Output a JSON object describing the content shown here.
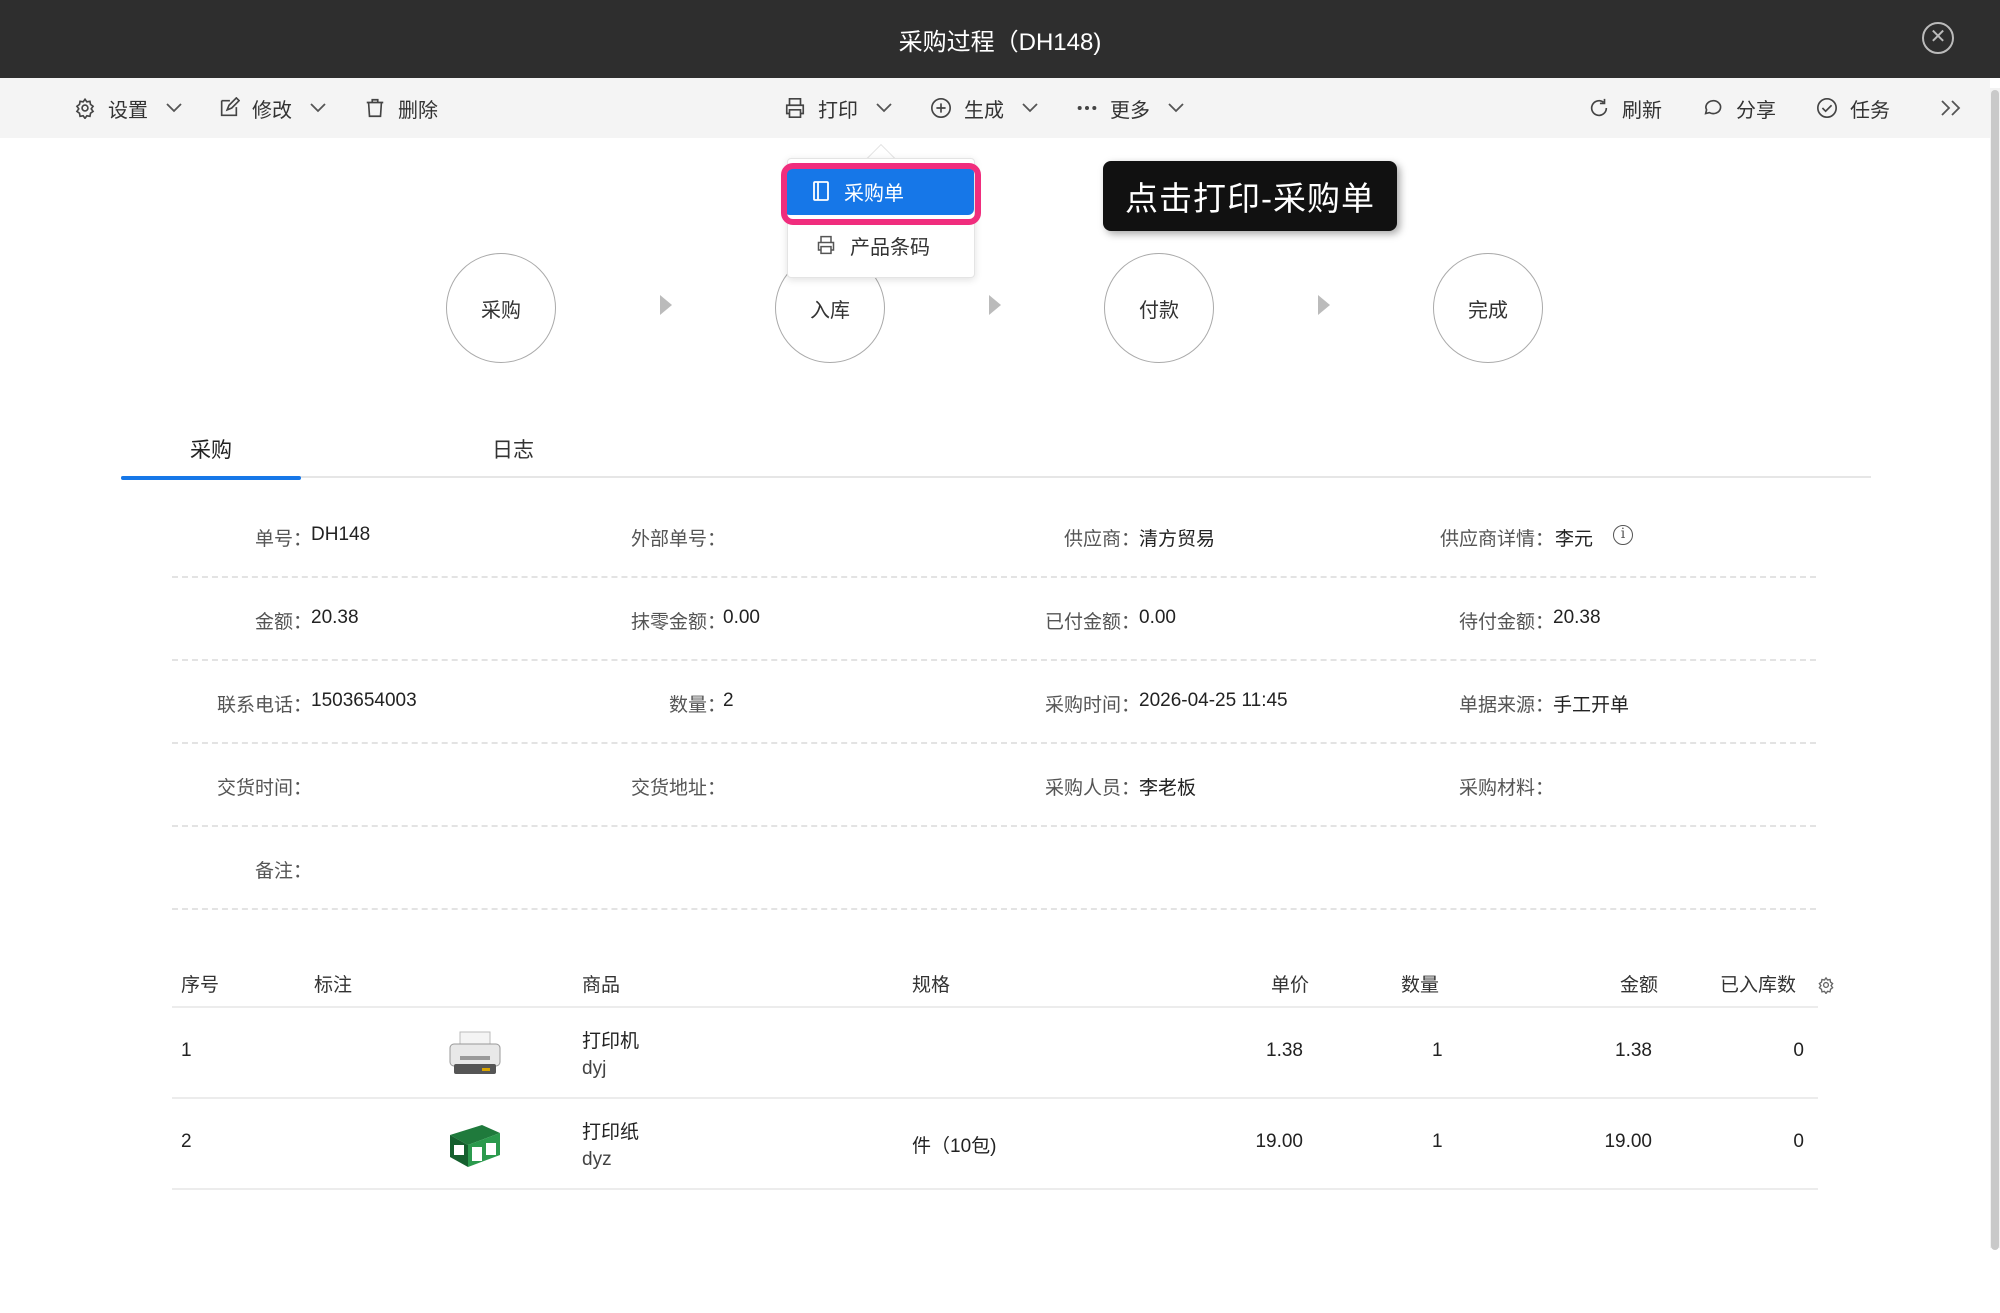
{
  "window": {
    "title": "采购过程（DH148)",
    "close_icon": "close-icon"
  },
  "toolbar": {
    "settings": "设置",
    "edit": "修改",
    "delete": "删除",
    "print": "打印",
    "generate": "生成",
    "more": "更多",
    "refresh": "刷新",
    "share": "分享",
    "task": "任务"
  },
  "print_menu": {
    "items": [
      "采购单",
      "产品条码"
    ],
    "selected": "采购单"
  },
  "callout": "点击打印-采购单",
  "steps": [
    "采购",
    "入库",
    "付款",
    "完成"
  ],
  "tabs": [
    "采购",
    "日志"
  ],
  "fields": {
    "order_no": {
      "label": "单号：",
      "value": "DH148"
    },
    "external_no": {
      "label": "外部单号：",
      "value": ""
    },
    "supplier": {
      "label": "供应商：",
      "value": "清方贸易"
    },
    "supplier_detail": {
      "label": "供应商详情：",
      "value": "李元"
    },
    "amount": {
      "label": "金额：",
      "value": "20.38"
    },
    "rounding": {
      "label": "抹零金额：",
      "value": "0.00"
    },
    "paid": {
      "label": "已付金额：",
      "value": "0.00"
    },
    "due": {
      "label": "待付金额：",
      "value": "20.38"
    },
    "phone": {
      "label": "联系电话：",
      "value": "1503654003"
    },
    "quantity": {
      "label": "数量：",
      "value": "2"
    },
    "purchase_time": {
      "label": "采购时间：",
      "value": "2026-04-25 11:45"
    },
    "source": {
      "label": "单据来源：",
      "value": "手工开单"
    },
    "delivery_time": {
      "label": "交货时间：",
      "value": ""
    },
    "delivery_addr": {
      "label": "交货地址：",
      "value": ""
    },
    "purchaser": {
      "label": "采购人员：",
      "value": "李老板"
    },
    "material": {
      "label": "采购材料：",
      "value": ""
    },
    "remark": {
      "label": "备注：",
      "value": ""
    }
  },
  "table": {
    "headers": {
      "seq": "序号",
      "mark": "标注",
      "product": "商品",
      "spec": "规格",
      "price": "单价",
      "qty": "数量",
      "amount": "金额",
      "stocked": "已入库数"
    },
    "rows": [
      {
        "seq": "1",
        "name": "打印机",
        "code": "dyj",
        "spec": "",
        "price": "1.38",
        "qty": "1",
        "amount": "1.38",
        "stocked": "0"
      },
      {
        "seq": "2",
        "name": "打印纸",
        "code": "dyz",
        "spec": "件（10包)",
        "price": "19.00",
        "qty": "1",
        "amount": "19.00",
        "stocked": "0"
      }
    ]
  },
  "colors": {
    "accent": "#1677e8",
    "highlight": "#f02d7d",
    "titlebar": "#2e2e2e"
  }
}
